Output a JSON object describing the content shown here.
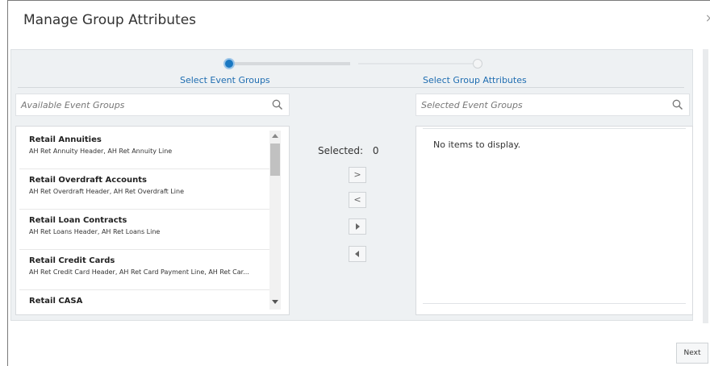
{
  "dialog": {
    "title": "Manage Group Attributes",
    "close_glyph": "×"
  },
  "train": {
    "steps": [
      {
        "label": "Select Event Groups",
        "state": "current"
      },
      {
        "label": "Select Group Attributes",
        "state": "pending"
      }
    ]
  },
  "available": {
    "placeholder": "Available Event Groups",
    "icon": "search-icon",
    "items": [
      {
        "name": "Retail Annuities",
        "desc": "AH Ret Annuity Header, AH Ret Annuity Line"
      },
      {
        "name": "Retail Overdraft Accounts",
        "desc": "AH Ret Overdraft Header, AH Ret Overdraft Line"
      },
      {
        "name": "Retail Loan Contracts",
        "desc": "AH Ret Loans Header, AH Ret Loans Line"
      },
      {
        "name": "Retail Credit Cards",
        "desc": "AH Ret Credit Card Header, AH Ret Card Payment Line, AH Ret Car..."
      },
      {
        "name": "Retail CASA",
        "desc": ""
      }
    ]
  },
  "shuttle": {
    "selected_label": "Selected:",
    "selected_count": "0",
    "buttons": [
      {
        "name": "move-selected-right-button",
        "glyph": ">"
      },
      {
        "name": "move-selected-left-button",
        "glyph": "<"
      },
      {
        "name": "move-all-right-button",
        "glyph": "▶"
      },
      {
        "name": "move-all-left-button",
        "glyph": "◀"
      }
    ]
  },
  "selected": {
    "placeholder": "Selected Event Groups",
    "icon": "search-icon",
    "empty_text": "No items to display."
  },
  "footer": {
    "next_label": "Next"
  },
  "colors": {
    "accent": "#1a78c2",
    "link": "#1f6db1",
    "panel_bg": "#eef1f3"
  }
}
